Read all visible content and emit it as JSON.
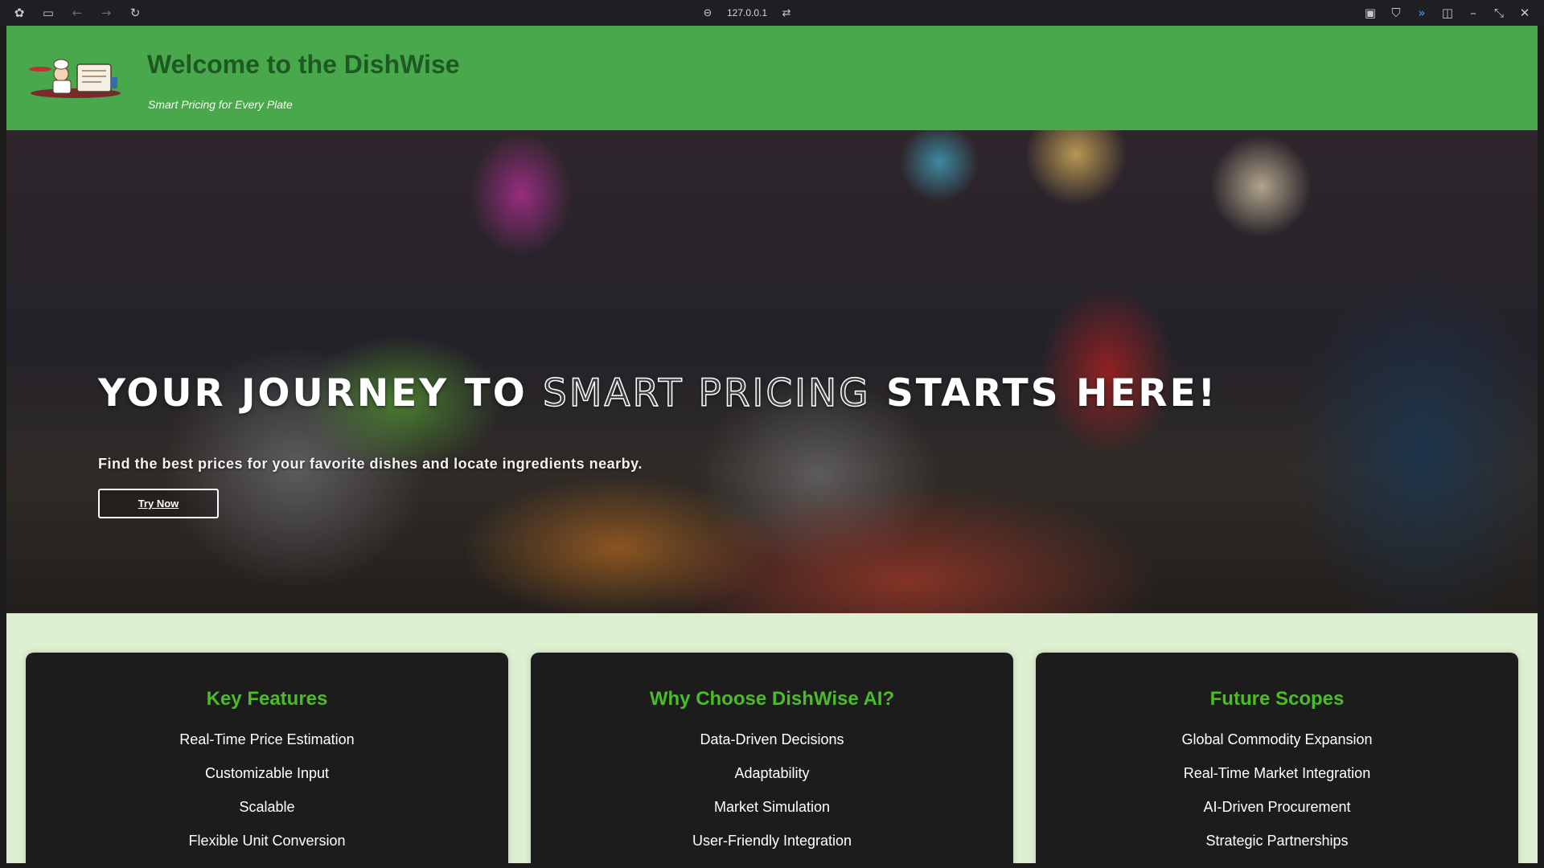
{
  "browser": {
    "address": "127.0.0.1",
    "icons": [
      "app-menu-icon",
      "sidebar-icon",
      "back-icon",
      "forward-icon",
      "reload-icon",
      "link-icon",
      "tune-icon",
      "extension-icon",
      "shield-icon",
      "audio-icon",
      "split-view-icon",
      "minimize-icon",
      "restore-icon",
      "close-icon"
    ]
  },
  "header": {
    "title": "Welcome to the DishWise",
    "tagline": "Smart Pricing for Every Plate"
  },
  "hero": {
    "title_start": "YOUR JOURNEY TO ",
    "title_accent": "SMART PRICING",
    "title_end": " STARTS HERE!",
    "subtitle": "Find the best prices for your favorite dishes and locate ingredients nearby.",
    "button_label": "Try Now"
  },
  "cards": [
    {
      "title": "Key Features",
      "items": [
        "Real-Time Price Estimation",
        "Customizable Input",
        "Scalable",
        "Flexible Unit Conversion"
      ]
    },
    {
      "title": "Why Choose DishWise AI?",
      "items": [
        "Data-Driven Decisions",
        "Adaptability",
        "Market Simulation",
        "User-Friendly Integration"
      ]
    },
    {
      "title": "Future Scopes",
      "items": [
        "Global Commodity Expansion",
        "Real-Time Market Integration",
        "AI-Driven Procurement",
        "Strategic Partnerships"
      ]
    }
  ],
  "colors": {
    "header_bg": "#4aa84c",
    "title_color": "#1d5a22",
    "page_bg": "#dcefd0",
    "card_bg": "#1c1c1c",
    "card_heading": "#4cbb2a"
  }
}
